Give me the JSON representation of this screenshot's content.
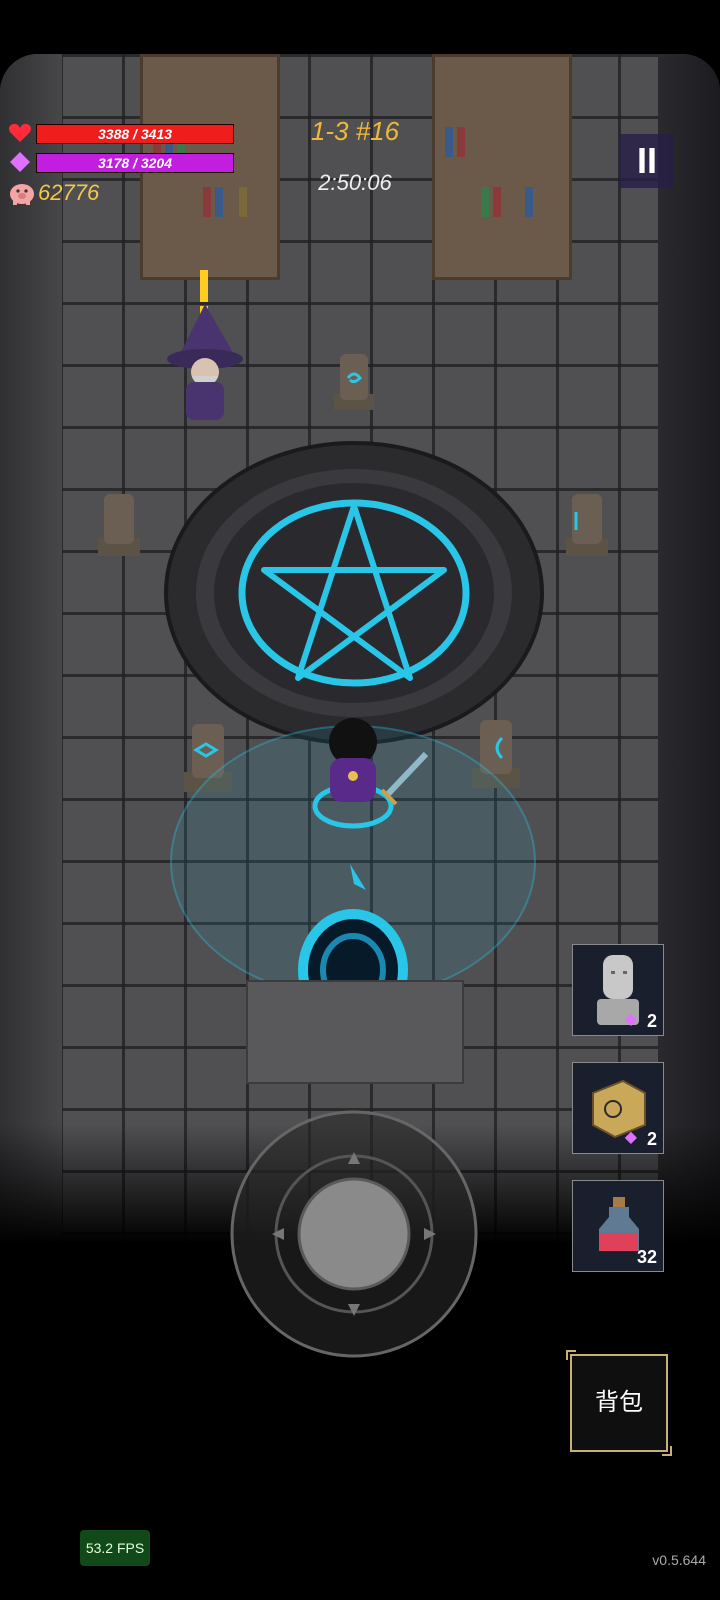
{
  "hud": {
    "hp_text": "3388 / 3413",
    "hp_fraction": 0.99,
    "mp_text": "3178 / 3204",
    "mp_fraction": 0.99,
    "gold": "62776",
    "stage": "1-3 #16",
    "timer": "2:50:06",
    "pause_label": "II"
  },
  "quickslots": [
    {
      "item": "stone-head-statue",
      "count": "2",
      "gem_icon": "diamond-icon"
    },
    {
      "item": "rune-cube",
      "count": "2",
      "gem_icon": "diamond-icon"
    },
    {
      "item": "red-potion",
      "count": "32"
    }
  ],
  "bag_label": "背包",
  "fps": "53.2 FPS",
  "version": "v0.5.644",
  "colors": {
    "hp": "#f01d1d",
    "mp": "#c21ee0",
    "gold": "#f0c948",
    "stage": "#f0b83b",
    "rune_glow": "#29c6e8"
  },
  "icons": [
    "heart-icon",
    "mana-gem-icon",
    "piggy-bank-icon",
    "pause-icon"
  ]
}
